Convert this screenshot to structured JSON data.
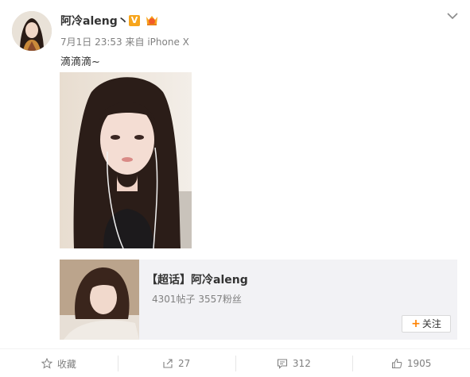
{
  "post": {
    "username": "阿冷aleng丶",
    "verified_badge": "V",
    "time": "7月1日 23:53",
    "source_prefix": "来自",
    "source": "iPhone X",
    "text": "滴滴滴~"
  },
  "topic_card": {
    "title": "【超话】阿冷aleng",
    "stats": "4301帖子 3557粉丝",
    "follow_plus": "+",
    "follow_label": "关注"
  },
  "actions": {
    "favorite": "收藏",
    "repost_count": "27",
    "comment_count": "312",
    "like_count": "1905"
  },
  "colors": {
    "accent": "#ff8200",
    "badge": "#f7a51c",
    "muted": "#808080",
    "card_bg": "#f2f2f5"
  }
}
